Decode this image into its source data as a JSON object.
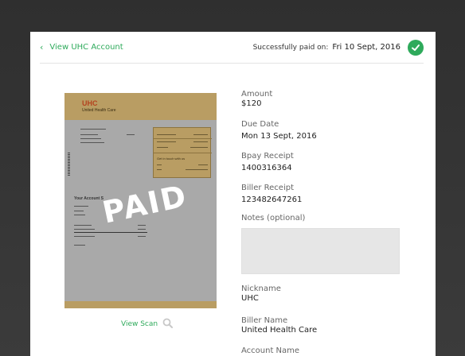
{
  "header": {
    "back_label": "View UHC Account",
    "paid_prefix": "Successfully paid on:",
    "paid_date": "Fri 10 Sept, 2016"
  },
  "bill": {
    "logo": "UHC",
    "company": "United Health Care",
    "stamp": "PAID",
    "box_heading": "Get in touch with us",
    "summary_heading": "Your Account S"
  },
  "scan": {
    "label": "View Scan"
  },
  "details": {
    "amount": {
      "label": "Amount",
      "value": "$120"
    },
    "due_date": {
      "label": "Due Date",
      "value": "Mon 13 Sept, 2016"
    },
    "bpay_receipt": {
      "label": "Bpay Receipt",
      "value": "1400316364"
    },
    "biller_receipt": {
      "label": "Biller Receipt",
      "value": "123482647261"
    },
    "notes": {
      "label": "Notes (optional)",
      "value": ""
    },
    "nickname": {
      "label": "Nickname",
      "value": "UHC"
    },
    "biller_name": {
      "label": "Biller Name",
      "value": "United Health Care"
    },
    "account_name": {
      "label": "Account Name"
    }
  },
  "colors": {
    "accent": "#2eaa5b",
    "bill_gold": "#b99d63",
    "bill_gray": "#a9a9a9"
  }
}
